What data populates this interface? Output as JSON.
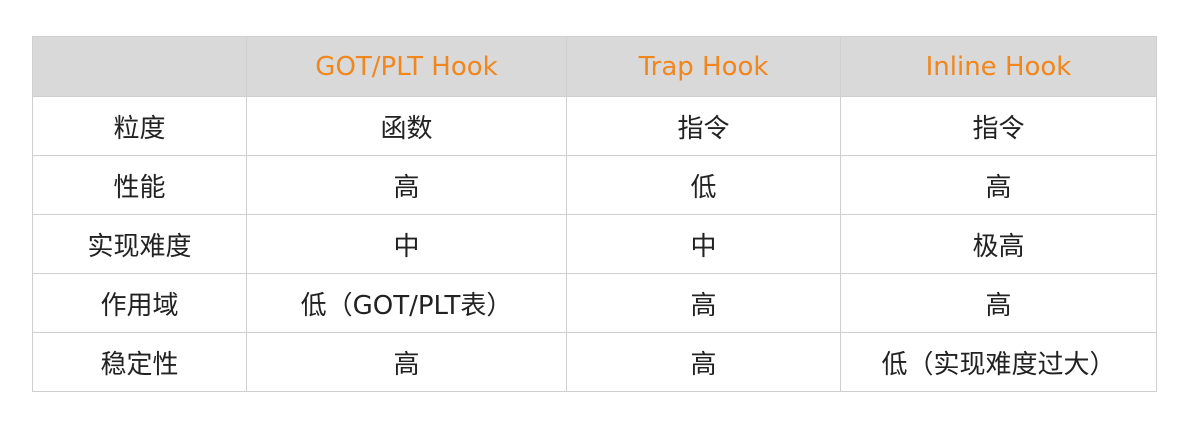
{
  "table": {
    "headers": [
      "",
      "GOT/PLT Hook",
      "Trap Hook",
      "Inline Hook"
    ],
    "rows": [
      [
        "粒度",
        "函数",
        "指令",
        "指令"
      ],
      [
        "性能",
        "高",
        "低",
        "高"
      ],
      [
        "实现难度",
        "中",
        "中",
        "极高"
      ],
      [
        "作用域",
        "低（GOT/PLT表）",
        "高",
        "高"
      ],
      [
        "稳定性",
        "高",
        "高",
        "低（实现难度过大）"
      ]
    ]
  },
  "colors": {
    "header_text": "#f0861c",
    "header_background": "#d9d9d9",
    "border": "#cfcfcf",
    "body_text": "#222222"
  }
}
